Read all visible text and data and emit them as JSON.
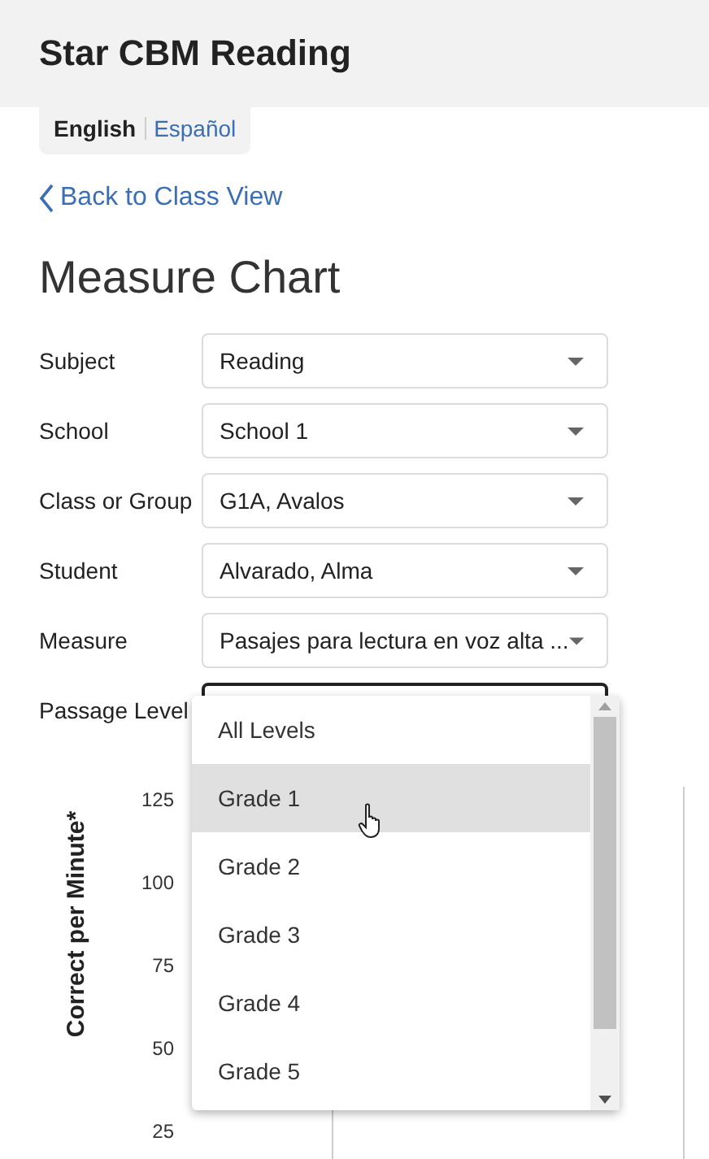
{
  "app_title": "Star CBM Reading",
  "languages": [
    {
      "label": "English",
      "selected": true
    },
    {
      "label": "Español",
      "selected": false
    }
  ],
  "back_link": "Back to Class View",
  "page_title": "Measure Chart",
  "filters": [
    {
      "label": "Subject",
      "value": "Reading",
      "open": false
    },
    {
      "label": "School",
      "value": "School 1",
      "open": false
    },
    {
      "label": "Class or Group",
      "value": "G1A, Avalos",
      "open": false
    },
    {
      "label": "Student",
      "value": "Alvarado, Alma",
      "open": false
    },
    {
      "label": "Measure",
      "value": "Pasajes para lectura en voz alta ...",
      "open": false
    },
    {
      "label": "Passage Level",
      "open": true,
      "options": [
        {
          "label": "All Levels",
          "hovered": false
        },
        {
          "label": "Grade 1",
          "hovered": true
        },
        {
          "label": "Grade 2",
          "hovered": false
        },
        {
          "label": "Grade 3",
          "hovered": false
        },
        {
          "label": "Grade 4",
          "hovered": false
        },
        {
          "label": "Grade 5",
          "hovered": false
        }
      ]
    }
  ],
  "chart": {
    "ylabel": "Correct per Minute*",
    "yticks": [
      "125",
      "100",
      "75",
      "50",
      "25"
    ]
  }
}
